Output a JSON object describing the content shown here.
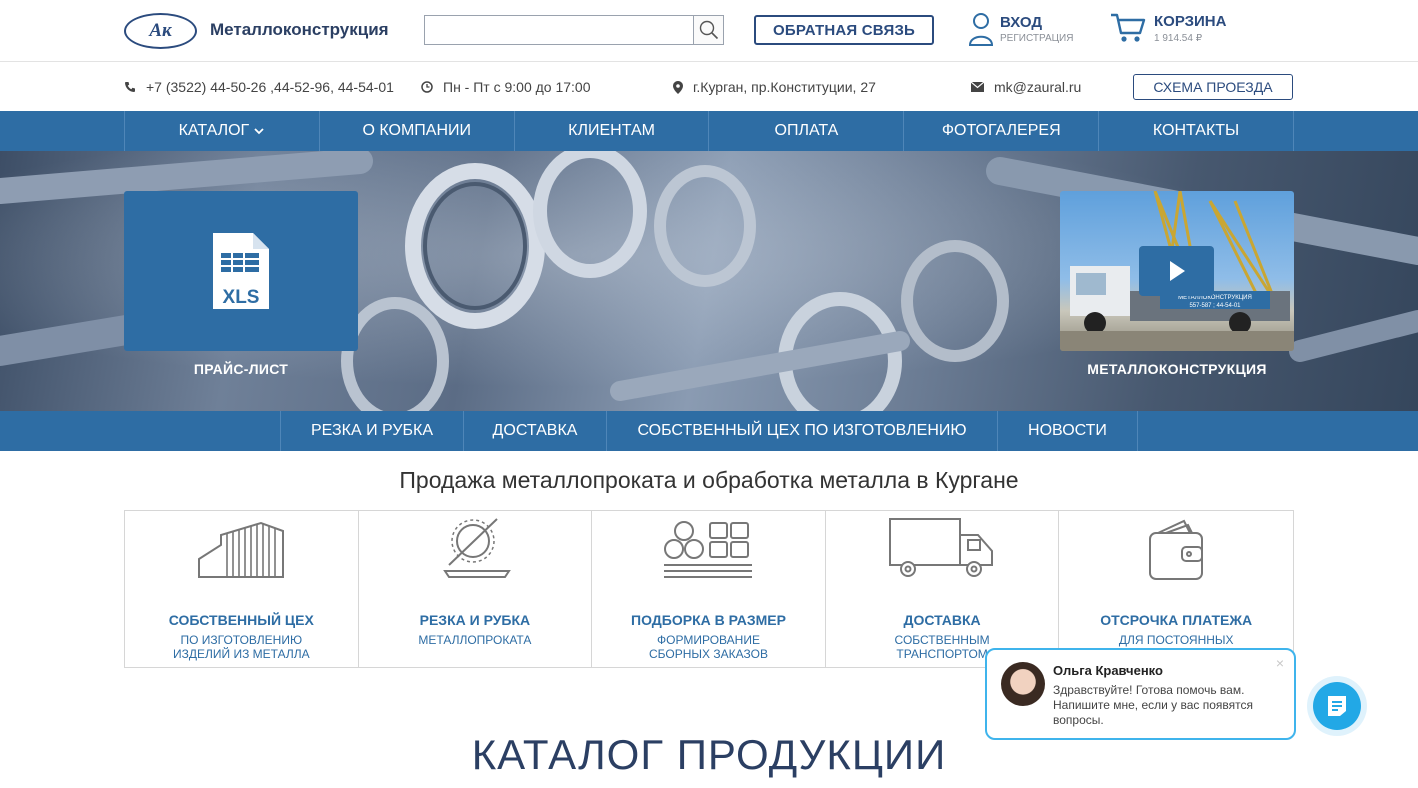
{
  "header": {
    "logo_text": "Ак",
    "company": "Металлоконструкция",
    "search_placeholder": "",
    "feedback_label": "ОБРАТНАЯ СВЯЗЬ",
    "login_label": "ВХОД",
    "register_label": "РЕГИСТРАЦИЯ",
    "cart_label": "КОРЗИНА",
    "cart_total": "1 914.54 ₽"
  },
  "info": {
    "phone": "+7 (3522) 44-50-26 ,44-52-96, 44-54-01",
    "hours": "Пн - Пт с 9:00 до 17:00",
    "address": "г.Курган, пр.Конституции, 27",
    "email": "mk@zaural.ru",
    "route_button": "СХЕМА ПРОЕЗДА"
  },
  "nav": [
    {
      "label": "КАТАЛОГ"
    },
    {
      "label": "О КОМПАНИИ"
    },
    {
      "label": "КЛИЕНТАМ"
    },
    {
      "label": "ОПЛАТА"
    },
    {
      "label": "ФОТОГАЛЕРЕЯ"
    },
    {
      "label": "КОНТАКТЫ"
    }
  ],
  "hero": {
    "price_list_icon_text": "XLS",
    "price_list_caption": "ПРАЙС-ЛИСТ",
    "video_caption": "МЕТАЛЛОКОНСТРУКЦИЯ",
    "truck_sign": "МЕТАЛЛОКОНСТРУКЦИЯ",
    "truck_phone": "557-587 ; 44-54-01"
  },
  "subnav": [
    {
      "label": "РЕЗКА И РУБКА"
    },
    {
      "label": "ДОСТАВКА"
    },
    {
      "label": "СОБСТВЕННЫЙ ЦЕХ ПО ИЗГОТОВЛЕНИЮ"
    },
    {
      "label": "НОВОСТИ"
    }
  ],
  "tagline": "Продажа металлопроката и обработка металла в Кургане",
  "features": [
    {
      "title": "СОБСТВЕННЫЙ ЦЕХ",
      "line1": "ПО ИЗГОТОВЛЕНИЮ",
      "line2": "ИЗДЕЛИЙ ИЗ МЕТАЛЛА",
      "icon": "workshop-icon"
    },
    {
      "title": "РЕЗКА И РУБКА",
      "line1": "МЕТАЛЛОПРОКАТА",
      "line2": "",
      "icon": "saw-icon"
    },
    {
      "title": "ПОДБОРКА В РАЗМЕР",
      "line1": "ФОРМИРОВАНИЕ",
      "line2": "СБОРНЫХ ЗАКАЗОВ",
      "icon": "stock-icon"
    },
    {
      "title": "ДОСТАВКА",
      "line1": "СОБСТВЕННЫМ",
      "line2": "ТРАНСПОРТОМ",
      "icon": "truck-icon"
    },
    {
      "title": "ОТСРОЧКА ПЛАТЕЖА",
      "line1": "ДЛЯ ПОСТОЯННЫХ",
      "line2": "",
      "icon": "wallet-icon"
    }
  ],
  "catalog_title": "КАТАЛОГ ПРОДУКЦИИ",
  "chat": {
    "name": "Ольга Кравченко",
    "message": "Здравствуйте! Готова помочь вам. Напишите мне, если у вас появятся вопросы.",
    "close": "×"
  },
  "colors": {
    "primary": "#2e6da4",
    "dark": "#2b4b7e",
    "chat_accent": "#22a8e6"
  }
}
